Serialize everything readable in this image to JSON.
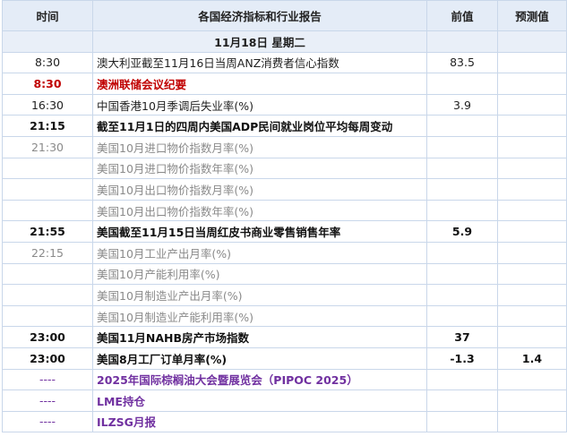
{
  "header": {
    "time": "时间",
    "event": "各国经济指标和行业报告",
    "previous": "前值",
    "forecast": "预测值"
  },
  "date_label": "11月18日 星期二",
  "rows": [
    {
      "time": "8:30",
      "event": "澳大利亚截至11月16日当周ANZ消费者信心指数",
      "previous": "83.5",
      "forecast": ""
    },
    {
      "time": "8:30",
      "event": "澳洲联储会议纪要",
      "previous": "",
      "forecast": ""
    },
    {
      "time": "16:30",
      "event": "中国香港10月季调后失业率(%)",
      "previous": "3.9",
      "forecast": ""
    },
    {
      "time": "21:15",
      "event": "截至11月1日的四周内美国ADP民间就业岗位平均每周变动",
      "previous": "",
      "forecast": ""
    },
    {
      "time": "21:30",
      "event": "美国10月进口物价指数月率(%)",
      "previous": "",
      "forecast": ""
    },
    {
      "time": "",
      "event": "美国10月进口物价指数年率(%)",
      "previous": "",
      "forecast": ""
    },
    {
      "time": "",
      "event": "美国10月出口物价指数月率(%)",
      "previous": "",
      "forecast": ""
    },
    {
      "time": "",
      "event": "美国10月出口物价指数年率(%)",
      "previous": "",
      "forecast": ""
    },
    {
      "time": "21:55",
      "event": "美国截至11月15日当周红皮书商业零售销售年率",
      "previous": "5.9",
      "forecast": ""
    },
    {
      "time": "22:15",
      "event": "美国10月工业产出月率(%)",
      "previous": "",
      "forecast": ""
    },
    {
      "time": "",
      "event": "美国10月产能利用率(%)",
      "previous": "",
      "forecast": ""
    },
    {
      "time": "",
      "event": "美国10月制造业产出月率(%)",
      "previous": "",
      "forecast": ""
    },
    {
      "time": "",
      "event": "美国10月制造业产能利用率(%)",
      "previous": "",
      "forecast": ""
    },
    {
      "time": "23:00",
      "event": "美国11月NAHB房产市场指数",
      "previous": "37",
      "forecast": ""
    },
    {
      "time": "23:00",
      "event": "美国8月工厂订单月率(%)",
      "previous": "-1.3",
      "forecast": "1.4"
    },
    {
      "time": "----",
      "event": "2025年国际棕榈油大会暨展览会（PIPOC 2025）",
      "previous": "",
      "forecast": ""
    },
    {
      "time": "----",
      "event": "LME持仓",
      "previous": "",
      "forecast": ""
    },
    {
      "time": "----",
      "event": "ILZSG月报",
      "previous": "",
      "forecast": ""
    }
  ],
  "colors": {
    "header_bg": "#e4ecf7",
    "date_bg": "#e9eff8",
    "border": "#c9d7ea",
    "red": "#c00000",
    "gray": "#8a8a8a",
    "purple": "#7030a0"
  }
}
